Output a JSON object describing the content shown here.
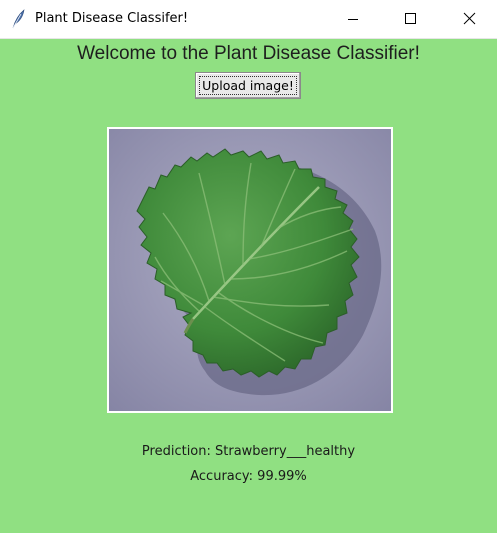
{
  "window": {
    "title": "Plant Disease Classifer!",
    "app_icon": "feather-icon",
    "controls": [
      "minimize-icon",
      "maximize-icon",
      "close-icon"
    ]
  },
  "main": {
    "welcome": "Welcome to the Plant Disease Classifier!",
    "upload_label": "Upload image!",
    "image": {
      "subject": "strawberry-leaf",
      "background_color": "#9d9cb8",
      "leaf_color": "#3f8a3a"
    },
    "prediction": "Prediction: Strawberry___healthy",
    "accuracy": "Accuracy: 99.99%"
  },
  "colors": {
    "background": "#90e082",
    "titlebar": "#ffffff",
    "button": "#e9e9e9"
  }
}
